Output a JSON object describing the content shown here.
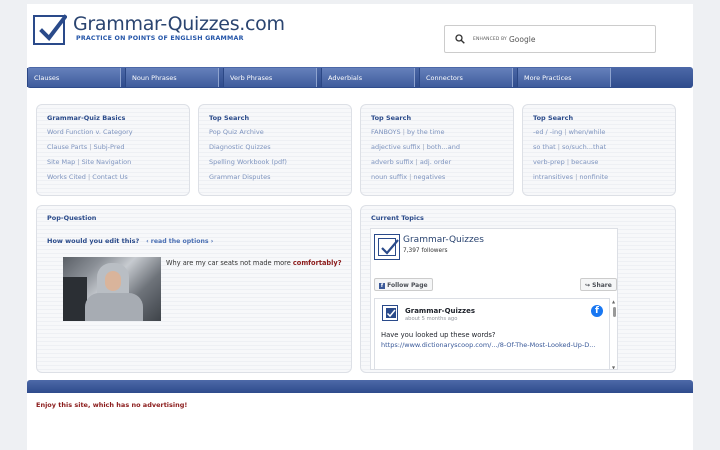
{
  "header": {
    "site_title": "Grammar-Quizzes.com",
    "tagline": "PRACTICE ON POINTS OF ENGLISH GRAMMAR",
    "search_enhanced": "ENHANCED BY",
    "search_brand": "Google"
  },
  "nav": [
    {
      "label": "Clauses"
    },
    {
      "label": "Noun Phrases"
    },
    {
      "label": "Verb Phrases"
    },
    {
      "label": "Adverbials"
    },
    {
      "label": "Connectors"
    },
    {
      "label": "More Practices"
    }
  ],
  "cards": [
    {
      "title": "Grammar-Quiz Basics",
      "rows": [
        [
          "Word Function v. Category"
        ],
        [
          "Clause Parts",
          "Subj-Pred"
        ],
        [
          "Site Map",
          "Site Navigation"
        ],
        [
          "Works Cited",
          "Contact Us"
        ]
      ]
    },
    {
      "title": "Top Search",
      "rows": [
        [
          "Pop Quiz Archive"
        ],
        [
          "Diagnostic Quizzes"
        ],
        [
          "Spelling Workbook (pdf)"
        ],
        [
          "Grammar Disputes"
        ]
      ]
    },
    {
      "title": "Top Search",
      "rows": [
        [
          "FANBOYS",
          "by the time"
        ],
        [
          "adjective suffix",
          "both...and"
        ],
        [
          "adverb suffix",
          "adj. order"
        ],
        [
          "noun suffix",
          "negatives"
        ]
      ]
    },
    {
      "title": "Top Search",
      "rows": [
        [
          "-ed / -ing",
          "when/while"
        ],
        [
          "so that",
          "so/such...that"
        ],
        [
          "verb-prep",
          "because"
        ],
        [
          "intransitives",
          "nonfinite"
        ]
      ]
    }
  ],
  "pop_question": {
    "title": "Pop-Question",
    "question": "How would you edit this?",
    "options_link": "‹ read the options ›",
    "sentence_start": "Why are my car seats not made more ",
    "sentence_emph": "comfortably?"
  },
  "current_topics": {
    "title": "Current Topics",
    "fb_page_name": "Grammar-Quizzes",
    "fb_followers": "7,397 followers",
    "follow_label": "Follow Page",
    "share_label": "Share",
    "post_author": "Grammar-Quizzes",
    "post_time": "about 5 months ago",
    "post_text": "Have you looked up these words?",
    "post_url": "https://www.dictionaryscoop.com/.../8-Of-The-Most-Looked-Up-D..."
  },
  "footer": {
    "note": "Enjoy this site, which has no advertising!"
  },
  "colors": {
    "brand_blue": "#2a4a8a",
    "nav_blue": "#3f5c9c",
    "link_muted": "#7d93be",
    "accent_red": "#8a1a1a",
    "facebook": "#1877f2"
  }
}
